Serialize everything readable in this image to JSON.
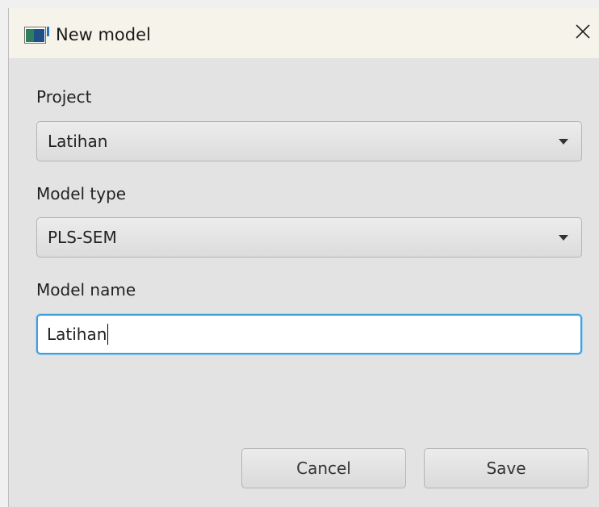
{
  "window": {
    "title": "New model",
    "icon": "app-window-icon",
    "close_icon": "close-icon"
  },
  "form": {
    "project_label": "Project",
    "project_value": "Latihan",
    "model_type_label": "Model type",
    "model_type_value": "PLS-SEM",
    "model_name_label": "Model name",
    "model_name_value": "Latihan"
  },
  "buttons": {
    "cancel_label": "Cancel",
    "save_label": "Save"
  },
  "colors": {
    "focus_border": "#3fa0dc",
    "titlebar_bg": "#f6f4ea",
    "dialog_bg": "#e3e3e3"
  }
}
